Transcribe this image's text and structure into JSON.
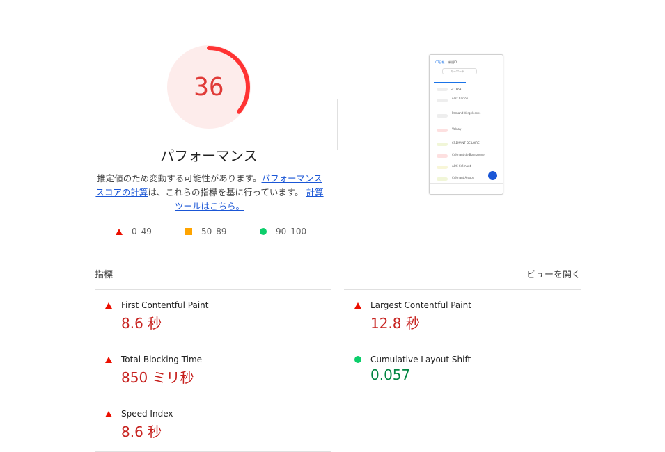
{
  "gauge": {
    "score": "36",
    "score_fraction": 0.36,
    "title": "パフォーマンス",
    "color": "#ff3333",
    "bg_color": "#fdeceb"
  },
  "description": {
    "text1": "推定値のため変動する可能性があります。",
    "link1": "パフォーマンス スコアの計算",
    "text2": "は、これらの指標を基に行っています。",
    "link2": "計算ツールはこちら。"
  },
  "legend": [
    {
      "label": "0–49",
      "icon": "fail-triangle-icon",
      "color": "#eb0f00"
    },
    {
      "label": "50–89",
      "icon": "average-square-icon",
      "color": "#ffa400"
    },
    {
      "label": "90–100",
      "icon": "pass-circle-icon",
      "color": "#0cce6b"
    }
  ],
  "screenshot": {
    "lines": [
      "ICT日報",
      "新規ID",
      "キーワード",
      "ECT963",
      "Alex Corton",
      "Pernand-Vergelesses",
      "Volnay",
      "CREMANT DE LOIRE",
      "Crémant de Bourgogne",
      "AOC Crémant",
      "Crémant Alsace"
    ]
  },
  "metrics_header": {
    "title": "指標",
    "toggle": "ビューを開く"
  },
  "metrics": [
    {
      "label": "First Contentful Paint",
      "value": "8.6 秒",
      "status": "fail"
    },
    {
      "label": "Largest Contentful Paint",
      "value": "12.8 秒",
      "status": "fail"
    },
    {
      "label": "Total Blocking Time",
      "value": "850 ミリ秒",
      "status": "fail"
    },
    {
      "label": "Cumulative Layout Shift",
      "value": "0.057",
      "status": "pass"
    },
    {
      "label": "Speed Index",
      "value": "8.6 秒",
      "status": "fail"
    }
  ]
}
